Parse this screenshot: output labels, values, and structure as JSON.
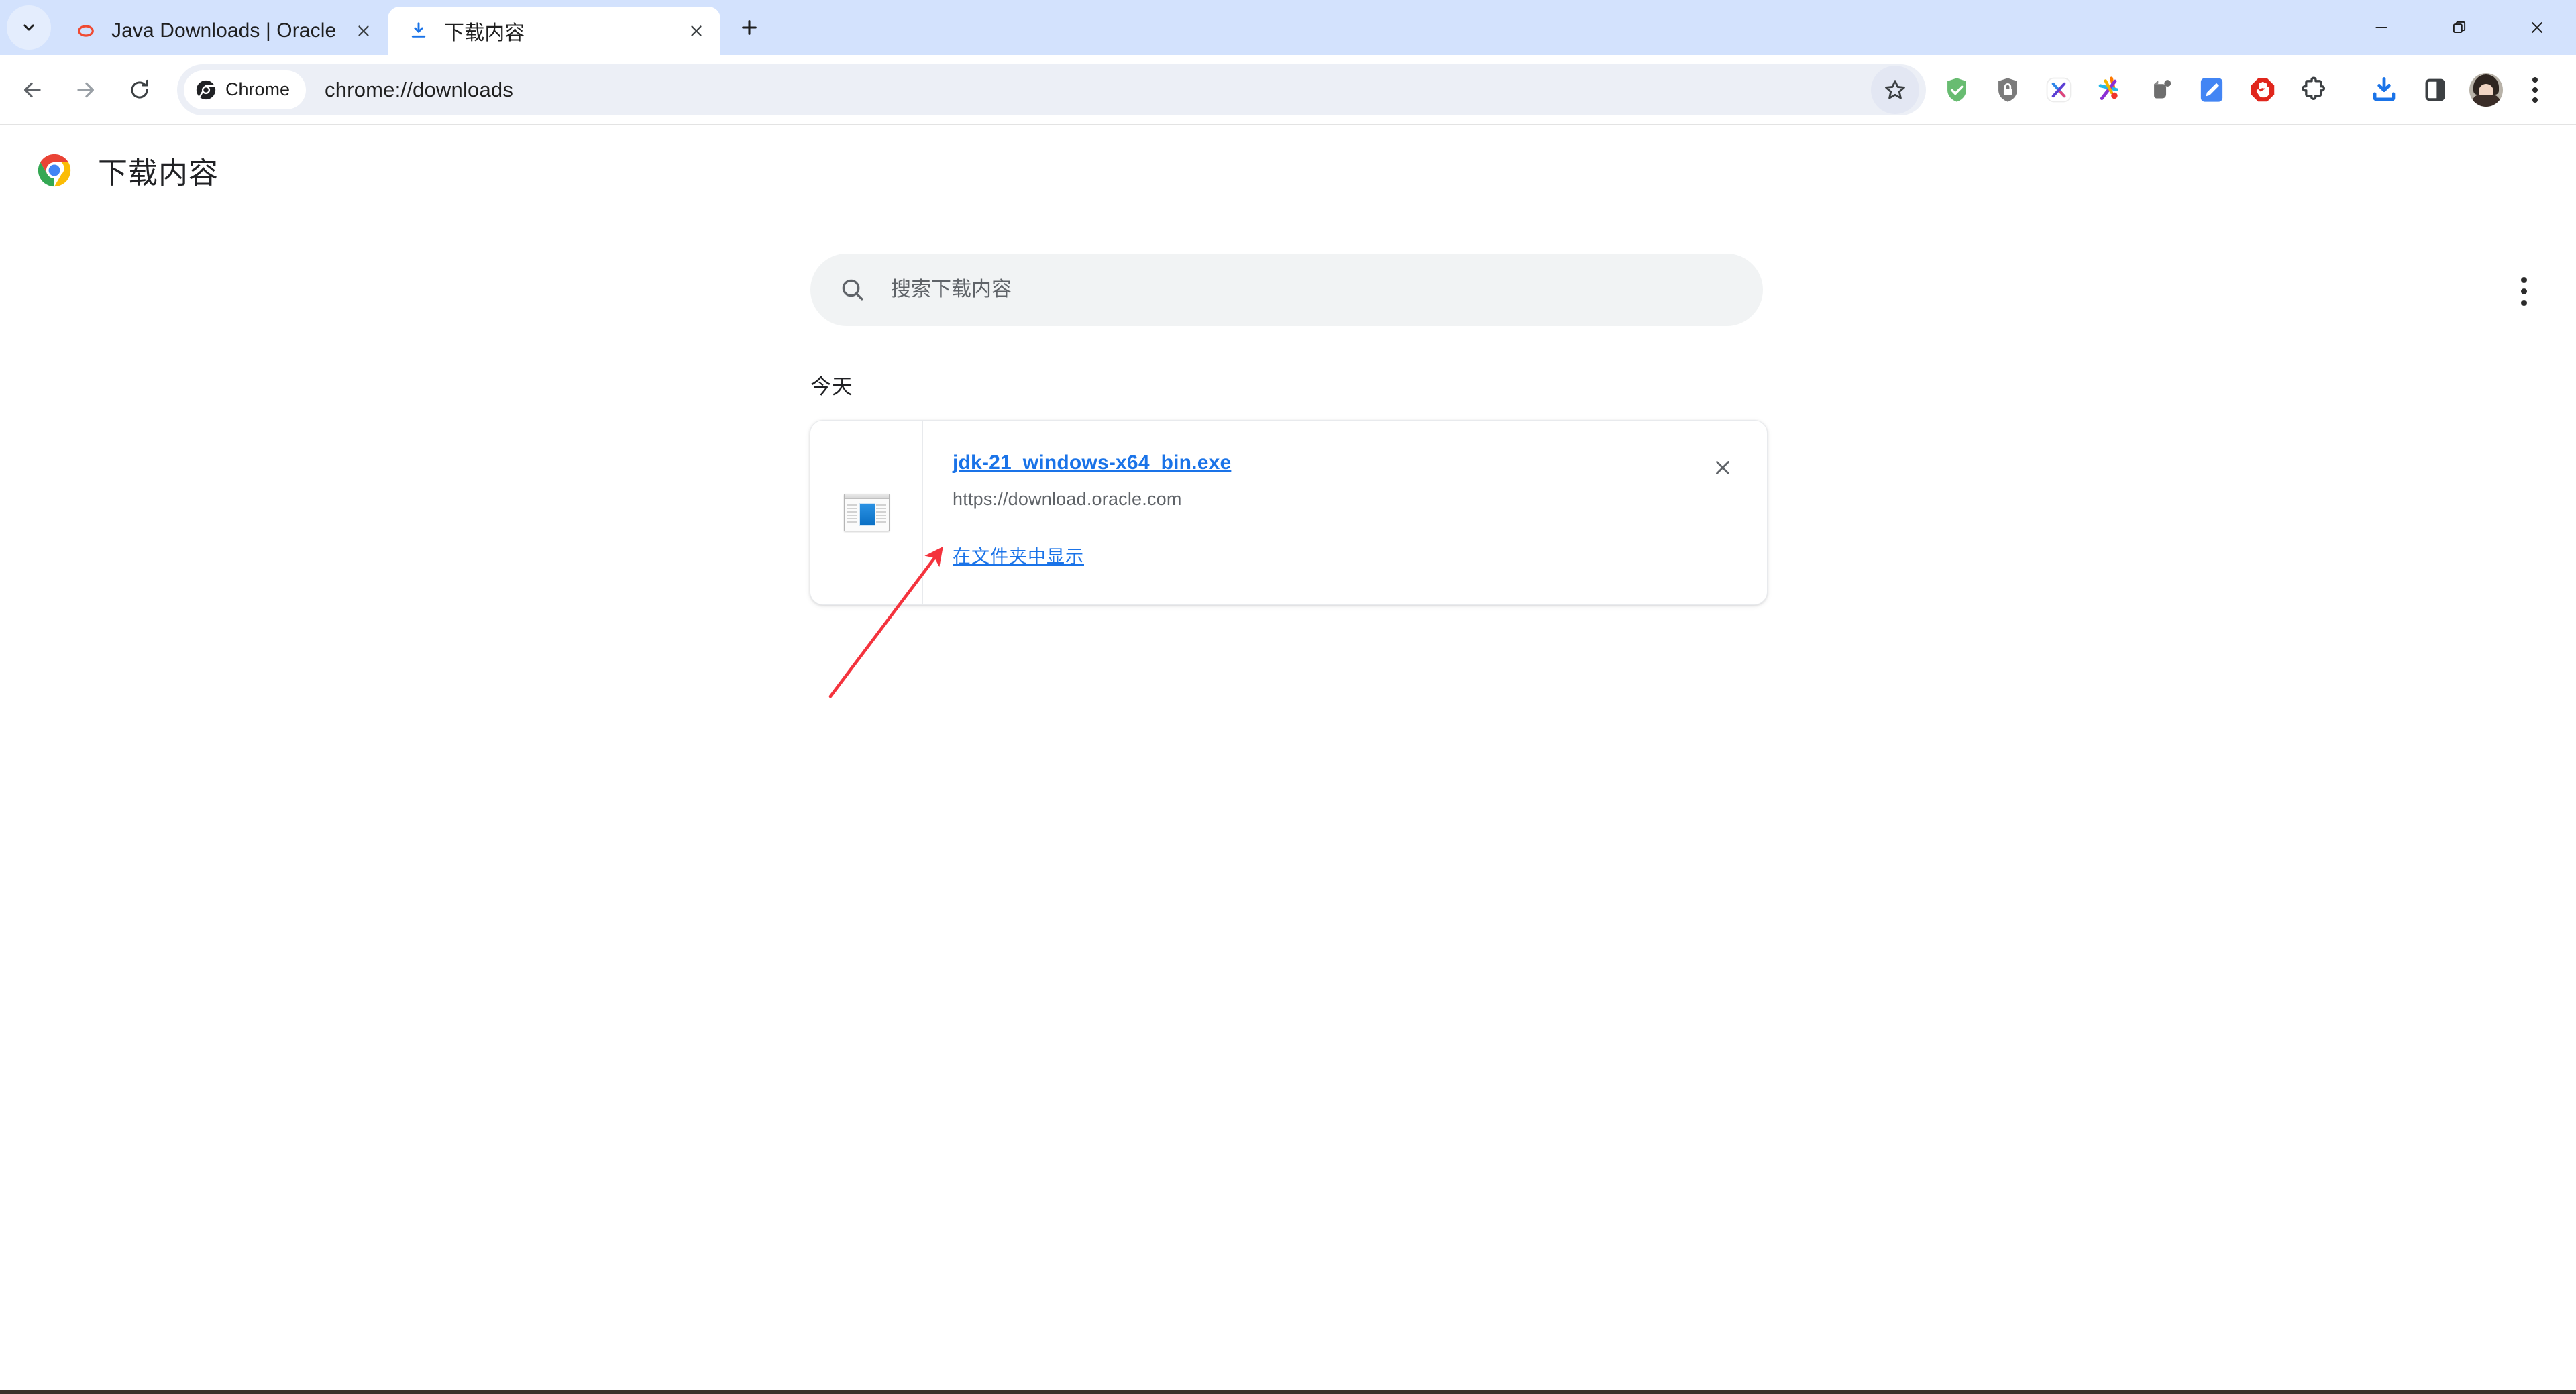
{
  "window": {
    "controls": [
      {
        "name": "minimize",
        "label": "最小化"
      },
      {
        "name": "restore",
        "label": "还原"
      },
      {
        "name": "close",
        "label": "关闭"
      }
    ]
  },
  "tabstrip": {
    "tab_search_tooltip": "搜索标签页",
    "new_tab_tooltip": "新建标签页",
    "tabs": [
      {
        "title": "Java Downloads | Oracle",
        "favicon": "oracle-icon",
        "active": false,
        "close_label": "关闭标签页"
      },
      {
        "title": "下载内容",
        "favicon": "download-icon",
        "active": true,
        "close_label": "关闭标签页"
      }
    ]
  },
  "toolbar": {
    "back_label": "返回",
    "forward_label": "前进",
    "reload_label": "重新加载",
    "chrome_chip_label": "Chrome",
    "url": "chrome://downloads",
    "bookmark_label": "为此标签页添加书签",
    "extensions": [
      {
        "name": "adguard-icon",
        "title": "AdGuard",
        "color": "#68bc71"
      },
      {
        "name": "privacy-shield-icon",
        "title": "Privacy Badger",
        "color": "#7a7a7a"
      },
      {
        "name": "x-extension-icon",
        "title": "X",
        "color": "#4285f4"
      },
      {
        "name": "colorful-star-icon",
        "title": "Star",
        "color": "#ff6d00"
      },
      {
        "name": "evernote-icon",
        "title": "Evernote",
        "color": "#6b6b6b"
      },
      {
        "name": "blue-note-icon",
        "title": "Note",
        "color": "#4285f4"
      },
      {
        "name": "adblock-icon",
        "title": "AdBlock",
        "color": "#e0261c"
      },
      {
        "name": "puzzle-piece-icon",
        "title": "扩展程序",
        "color": "#3c4043"
      }
    ],
    "downloads_button_label": "下载内容",
    "side_panel_label": "侧边栏",
    "profile_label": "个人资料",
    "chrome_menu_label": "自定义及控制 Google Chrome"
  },
  "downloads_page": {
    "title": "下载内容",
    "logo": "chrome-logo-icon",
    "search": {
      "placeholder": "搜索下载内容",
      "value": "",
      "icon": "search-icon"
    },
    "more_actions_label": "更多操作",
    "sections": [
      {
        "date_label": "今天",
        "items": [
          {
            "file_name": "jdk-21_windows-x64_bin.exe",
            "source_url": "https://download.oracle.com",
            "action_label": "在文件夹中显示",
            "remove_label": "从列表中移除",
            "file_icon": "exe-installer-icon"
          }
        ]
      }
    ]
  },
  "annotation": {
    "type": "arrow",
    "color": "#f4333d",
    "points_to": "在文件夹中显示"
  },
  "colors": {
    "tabstrip_bg": "#d3e2fd",
    "active_tab_bg": "#ffffff",
    "omnibox_bg": "#eceff6",
    "link_blue": "#1a73e8",
    "search_bg": "#f1f3f4",
    "annotation_red": "#f4333d"
  }
}
